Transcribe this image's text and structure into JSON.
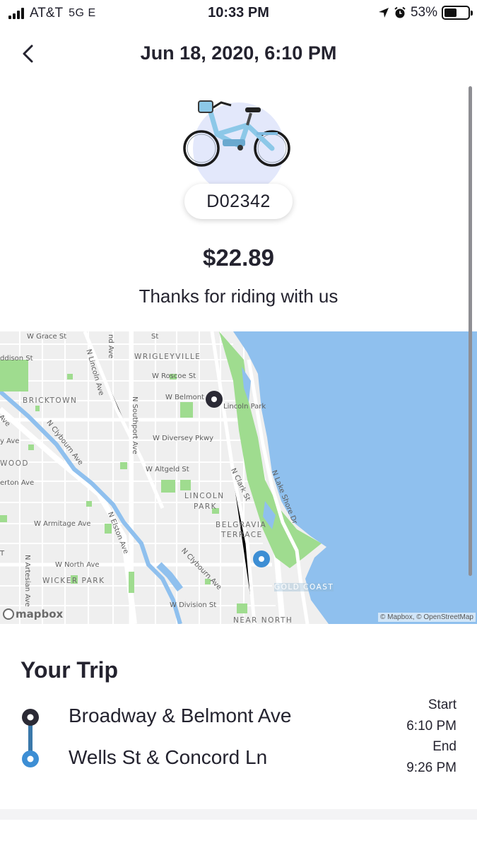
{
  "status_bar": {
    "carrier": "AT&T",
    "network": "5G E",
    "time": "10:33 PM",
    "battery_percent_label": "53%",
    "battery_level": 0.53
  },
  "header": {
    "title": "Jun 18, 2020, 6:10 PM",
    "back_icon": "chevron-left-icon"
  },
  "bike": {
    "id": "D02342",
    "color": "#8cc8e8"
  },
  "ride": {
    "price": "$22.89",
    "thanks": "Thanks for riding with us"
  },
  "map": {
    "labels": {
      "grace": "W Grace St",
      "addison": "ddison St",
      "wrigleyville": "WRIGLEYVILLE",
      "roscoe": "W Roscoe St",
      "belmont": "W Belmont",
      "lincoln_park_label": "Lincoln Park",
      "bricktown": "BRICKTOWN",
      "diversey": "W Diversey Pkwy",
      "wood": "WOOD",
      "altgeld": "W Altgeld St",
      "lincoln_park_area_1": "LINCOLN",
      "lincoln_park_area_2": "PARK",
      "armitage": "W Armitage Ave",
      "belgravia_1": "BELGRAVIA",
      "belgravia_2": "TERRACE",
      "north_ave": "W North Ave",
      "wicker_park": "WICKER PARK",
      "gold_coast": "GOLD COAST",
      "division": "W Division St",
      "near_north": "NEAR NORTH",
      "lincoln_ave": "N Lincoln Ave",
      "southport": "N Southport Ave",
      "clybourn_1": "N Clybourn Ave",
      "clybourn_2": "N Clybourn Ave",
      "clark": "N Clark St",
      "elston": "N Elston Ave",
      "lsd": "N Lake Shore Dr",
      "ashland": "nd Ave",
      "artesian": "N Artesian Ave",
      "ave_left": "Ave",
      "y_ave": "y Ave",
      "erton_ave": "erton Ave",
      "st_top": "St",
      "t_left": "T"
    },
    "logo": "mapbox",
    "attribution": "© Mapbox, © OpenStreetMap",
    "start_pin_color": "#2b2a35",
    "end_pin_color": "#3d8ed4",
    "water_color": "#8fc0ee",
    "park_color": "#9fdc8f"
  },
  "trip": {
    "heading": "Your Trip",
    "start_station": "Broadway & Belmont Ave",
    "end_station": "Wells St & Concord Ln",
    "start_label": "Start",
    "start_time": "6:10 PM",
    "end_label": "End",
    "end_time": "9:26 PM"
  }
}
